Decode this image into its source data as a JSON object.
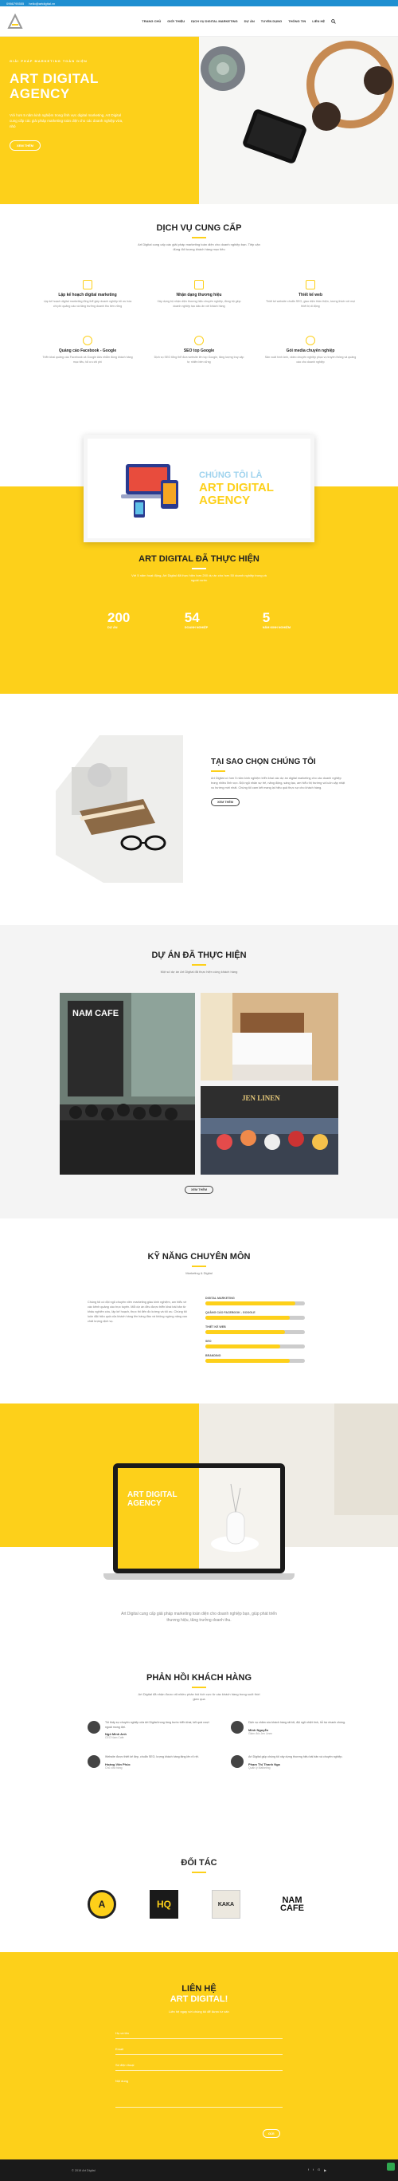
{
  "topbar": {
    "phone": "0966795555",
    "email": "hello@artdigital.vn"
  },
  "nav": {
    "items": [
      "TRANG CHỦ",
      "GIỚI THIỆU",
      "DỊCH VỤ DIGITAL MARKETING",
      "DỰ ÁN",
      "TUYỂN DỤNG",
      "THÔNG TIN",
      "LIÊN HỆ"
    ],
    "search_icon": "search-icon"
  },
  "hero": {
    "eyebrow": "GIẢI PHÁP MARKETING TOÀN DIỆN",
    "title_line1": "ART DIGITAL",
    "title_line2": "AGENCY",
    "description": "Với hơn 5 năm kinh nghiệm trong lĩnh vực digital marketing, Art Digital cung cấp các giải pháp marketing toàn diện cho các doanh nghiệp vừa, nhỏ",
    "button": "XEM THÊM"
  },
  "services": {
    "title": "DỊCH VỤ CUNG CẤP",
    "subtitle": "Art Digital cung cấp các giải pháp marketing toàn diện cho doanh nghiệp bạn. Tiếp cận đúng đối tượng khách hàng mục tiêu",
    "items": [
      {
        "title": "Lập kế hoạch digital marketing",
        "desc": "Lập kế hoạch digital marketing tổng thể giúp doanh nghiệp tối ưu hóa chi phí quảng cáo và tăng trưởng doanh thu bền vững",
        "icon": "plan-icon"
      },
      {
        "title": "Nhận dạng thương hiệu",
        "desc": "Xây dựng bộ nhận diện thương hiệu chuyên nghiệp, đồng bộ giúp doanh nghiệp tạo dấu ấn với khách hàng",
        "icon": "brand-icon"
      },
      {
        "title": "Thiết kế web",
        "desc": "Thiết kế website chuẩn SEO, giao diện thân thiện, tương thích với mọi thiết bị di động",
        "icon": "web-icon"
      },
      {
        "title": "Quảng cáo Facebook - Google",
        "desc": "Triển khai quảng cáo Facebook và Google Ads nhắm đúng khách hàng mục tiêu, tối ưu chi phí",
        "icon": "ads-icon"
      },
      {
        "title": "SEO top Google",
        "desc": "Dịch vụ SEO tổng thể đưa website lên top Google, tăng lượng truy cập tự nhiên bền vững",
        "icon": "seo-icon"
      },
      {
        "title": "Gói media chuyên nghiệp",
        "desc": "Sản xuất hình ảnh, video chuyên nghiệp phục vụ truyền thông và quảng cáo cho doanh nghiệp",
        "icon": "media-icon"
      }
    ]
  },
  "laptop_card": {
    "line1": "CHÚNG TÔI LÀ",
    "line2": "ART DIGITAL",
    "line3": "AGENCY"
  },
  "stats": {
    "title": "ART DIGITAL ĐÃ THỰC HIỆN",
    "subtitle": "Với 5 năm hoạt động, Art Digital đã thực hiện hơn 200 dự án cho hơn 50 doanh nghiệp trong và ngoài nước",
    "items": [
      {
        "num": "200",
        "label": "DỰ ÁN"
      },
      {
        "num": "54",
        "label": "DOANH NGHIỆP"
      },
      {
        "num": "5",
        "label": "NĂM KINH NGHIỆM"
      }
    ]
  },
  "why": {
    "title": "TẠI SAO CHỌN CHÚNG TÔI",
    "text": "Art Digital có hơn 5 năm kinh nghiệm triển khai các dự án digital marketing cho các doanh nghiệp trong nhiều lĩnh vực. Đội ngũ nhân sự trẻ, năng động, sáng tạo, am hiểu thị trường và luôn cập nhật xu hướng mới nhất. Chúng tôi cam kết mang lại hiệu quả thực sự cho khách hàng.",
    "button": "XEM THÊM"
  },
  "projects": {
    "title": "DỰ ÁN ĐÃ THỰC HIỆN",
    "subtitle": "Một số dự án Art Digital đã thực hiện cùng khách hàng",
    "button": "XEM THÊM",
    "cafe_sign": "NAM CAFE",
    "shop_sign": "JEN LINEN"
  },
  "skills": {
    "title": "KỸ NĂNG CHUYÊN MÔN",
    "subtitle": "Marketing & Digital",
    "text": "Chúng tôi có đội ngũ chuyên viên marketing giàu kinh nghiệm, am hiểu về các kênh quảng cáo trực tuyến. Mỗi dự án đều được triển khai bài bản từ khâu nghiên cứu, lập kế hoạch, thực thi đến đo lường và tối ưu. Chúng tôi luôn đặt hiệu quả của khách hàng lên hàng đầu và không ngừng nâng cao chất lượng dịch vụ.",
    "items": [
      {
        "label": "DIGITAL MARKETING",
        "value": 0.9
      },
      {
        "label": "QUẢNG CÁO FACEBOOK - GOOGLE",
        "value": 0.85
      },
      {
        "label": "THIẾT KẾ WEB",
        "value": 0.8
      },
      {
        "label": "SEO",
        "value": 0.75
      },
      {
        "label": "BRANDING",
        "value": 0.85
      }
    ]
  },
  "showcase": {
    "line1": "ART DIGITAL",
    "line2": "AGENCY",
    "caption": "Art Digital cung cấp giải pháp marketing toàn diện cho doanh nghiệp bạn, giúp phát triển thương hiệu, tăng trưởng doanh thu."
  },
  "testimonials": {
    "title": "PHẢN HỒI KHÁCH HÀNG",
    "subtitle": "Art Digital đã nhận được rất nhiều phản hồi tích cực từ các khách hàng trong suốt thời gian qua",
    "items": [
      {
        "text": "Tôi thấy sự chuyên nghiệp của Art Digital trong từng bước triển khai, kết quả vượt ngoài mong đợi.",
        "name": "Ngô Minh Anh",
        "role": "CEO Nam Cafe"
      },
      {
        "text": "Dịch vụ chăm sóc khách hàng rất tốt, đội ngũ nhiệt tình, hỗ trợ nhanh chóng.",
        "name": "Minh Nguyễn",
        "role": "Giám đốc Jen Linen"
      },
      {
        "text": "Website được thiết kế đẹp, chuẩn SEO, lượng khách hàng tăng lên rõ rệt.",
        "name": "Hoàng Văn Phúc",
        "role": "Chủ cửa hàng"
      },
      {
        "text": "Art Digital giúp chúng tôi xây dựng thương hiệu bài bản và chuyên nghiệp.",
        "name": "Phạm Thị Thanh Nga",
        "role": "Quản lý Marketing"
      }
    ]
  },
  "partners": {
    "title": "ĐỐI TÁC",
    "items": [
      "A",
      "HQ",
      "KAKA",
      "NAM CAFE"
    ]
  },
  "contact": {
    "title_line1": "LIÊN HỆ",
    "title_line2": "ART DIGITAL!",
    "subtitle": "Liên hệ ngay với chúng tôi để được tư vấn",
    "fields": [
      "Họ và tên",
      "Email",
      "Số điện thoại",
      "Nội dung"
    ],
    "button": "GỬI"
  },
  "footer": {
    "copyright": "© 2019 Art Digital",
    "socials": [
      "facebook-icon",
      "twitter-icon",
      "google-icon",
      "youtube-icon"
    ]
  },
  "colors": {
    "accent": "#fdd01a",
    "topbar": "#1f8fd1",
    "dark": "#1a1a1a"
  }
}
